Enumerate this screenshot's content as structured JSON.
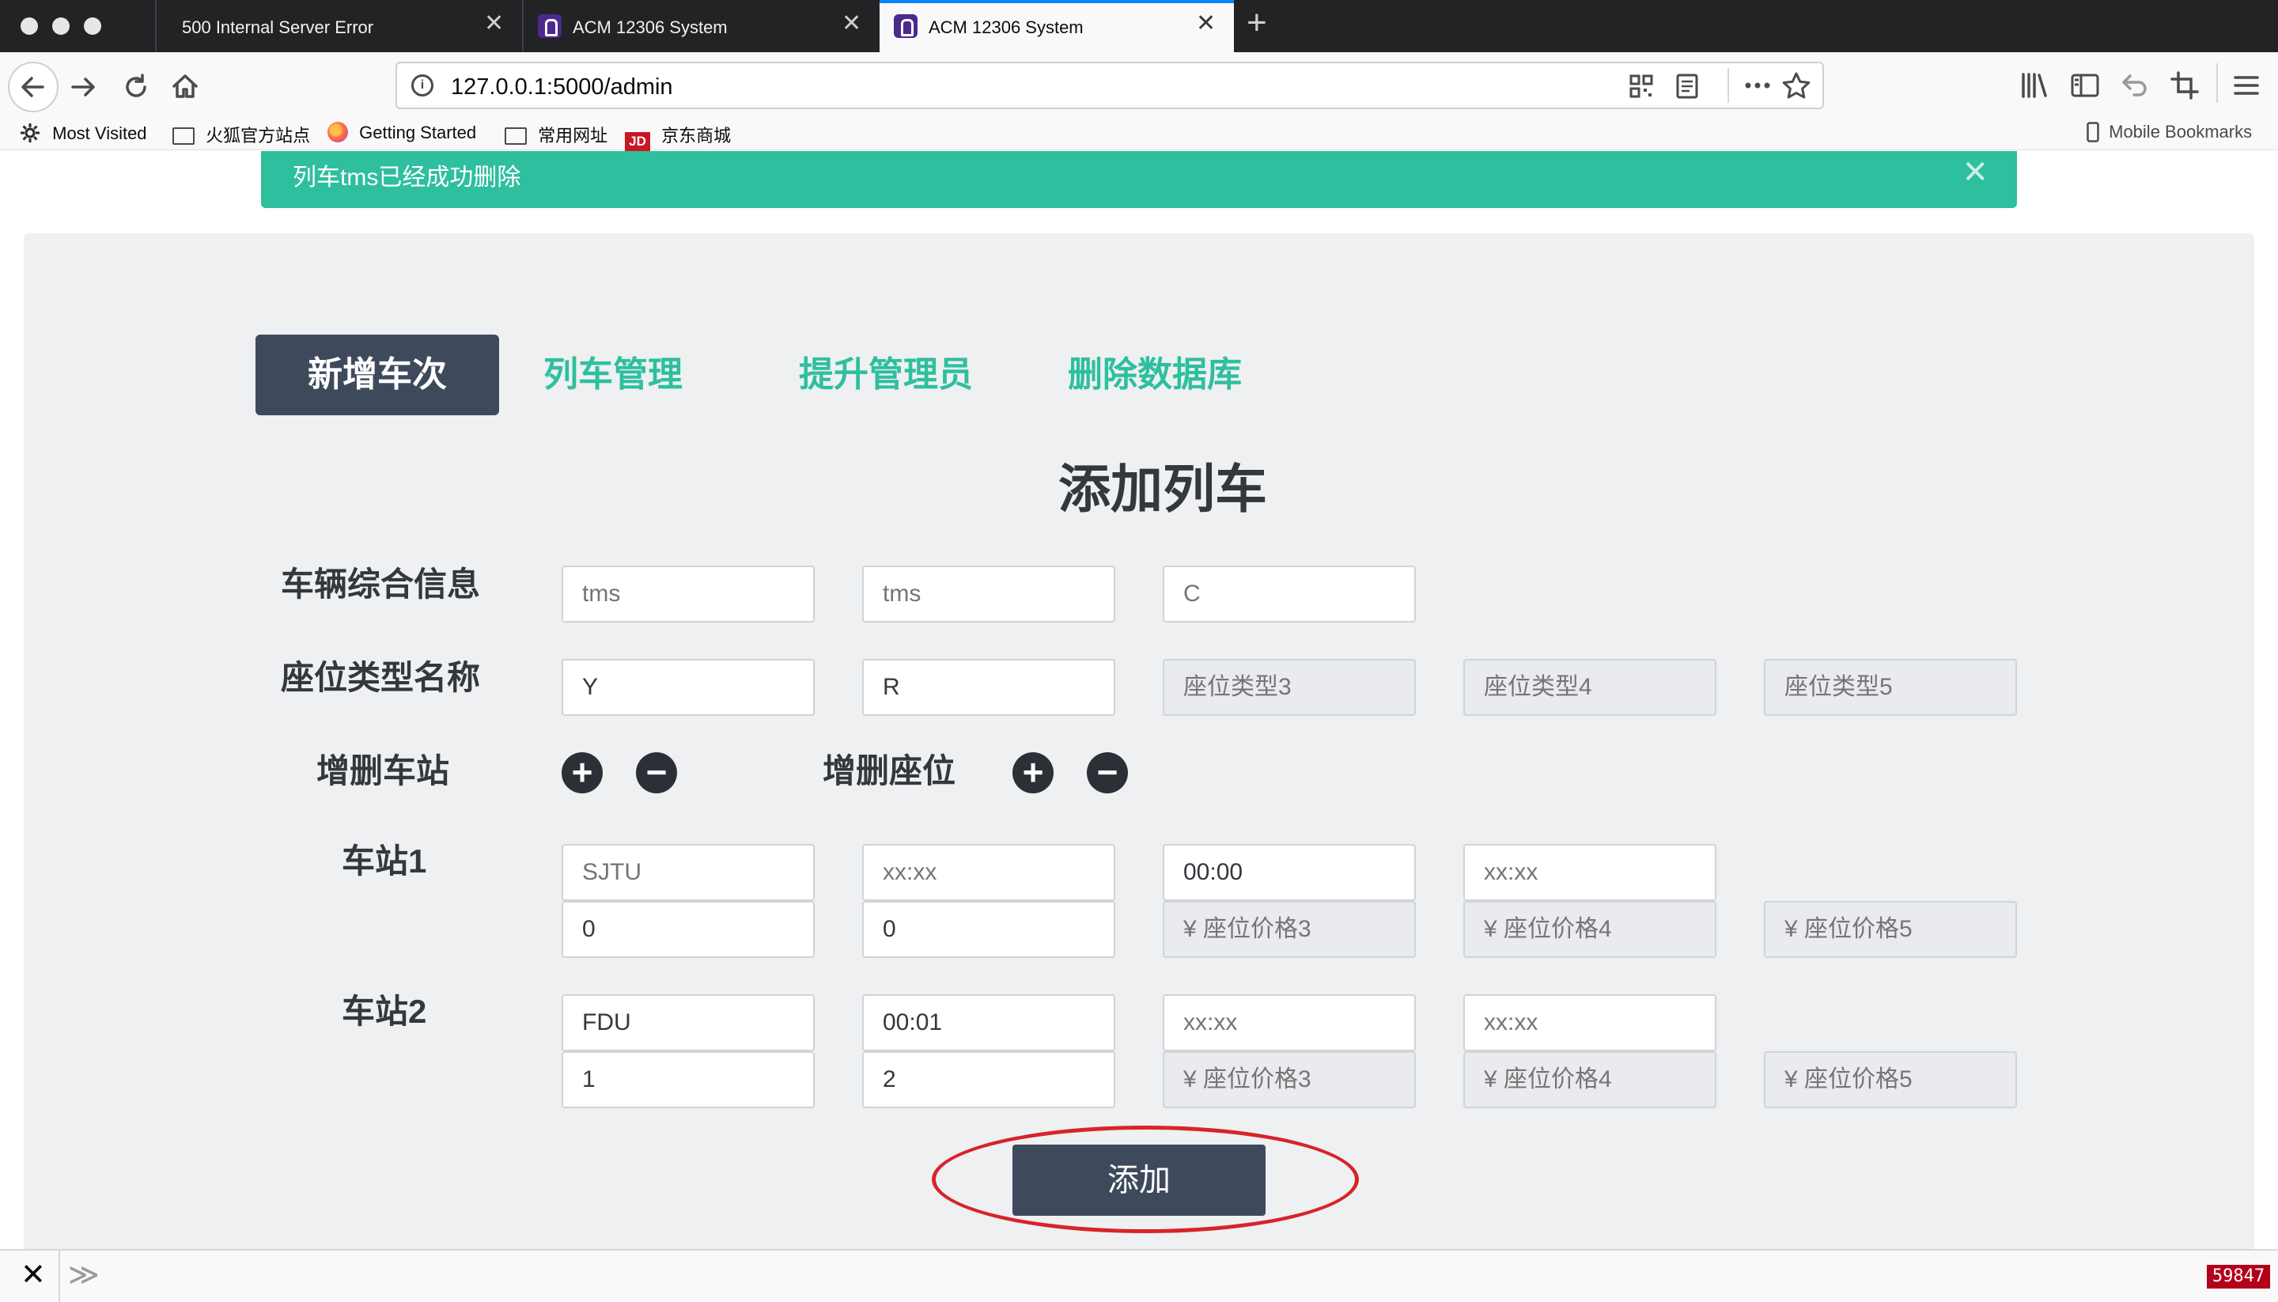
{
  "browser": {
    "tabs": [
      {
        "title": "500 Internal Server Error",
        "active": false
      },
      {
        "title": "ACM 12306 System",
        "active": false
      },
      {
        "title": "ACM 12306 System",
        "active": true
      }
    ],
    "new_tab_symbol": "+",
    "tab_close_symbol": "✕",
    "url": "127.0.0.1:5000/admin",
    "bookmarks": [
      {
        "label": "Most Visited",
        "icon": "gear-icon"
      },
      {
        "label": "火狐官方站点",
        "icon": "folder-icon"
      },
      {
        "label": "Getting Started",
        "icon": "firefox-icon"
      },
      {
        "label": "常用网址",
        "icon": "folder-icon"
      },
      {
        "label": "京东商城",
        "icon": "jd-icon"
      }
    ],
    "jd_icon_text": "JD",
    "mobile_bookmarks": "Mobile Bookmarks"
  },
  "alert": {
    "message": "列车tms已经成功删除",
    "close_symbol": "✕",
    "color": "#2ebf9e"
  },
  "nav": {
    "tabs": [
      {
        "label": "新增车次",
        "active": true
      },
      {
        "label": "列车管理",
        "active": false
      },
      {
        "label": "提升管理员",
        "active": false
      },
      {
        "label": "删除数据库",
        "active": false
      }
    ]
  },
  "form": {
    "title": "添加列车",
    "train_info_label": "车辆综合信息",
    "train_info": [
      {
        "value": "",
        "placeholder": "tms"
      },
      {
        "value": "",
        "placeholder": "tms"
      },
      {
        "value": "",
        "placeholder": "C"
      }
    ],
    "seat_type_label": "座位类型名称",
    "seat_types": [
      {
        "value": "Y",
        "placeholder": ""
      },
      {
        "value": "R",
        "placeholder": ""
      },
      {
        "value": "",
        "placeholder": "座位类型3"
      },
      {
        "value": "",
        "placeholder": "座位类型4"
      },
      {
        "value": "",
        "placeholder": "座位类型5"
      }
    ],
    "station_edit_label": "增删车站",
    "seat_edit_label": "增删座位",
    "plus_symbol": "+",
    "minus_symbol": "−",
    "stations": [
      {
        "label": "车站1",
        "row1": [
          {
            "value": "",
            "placeholder": "SJTU"
          },
          {
            "value": "",
            "placeholder": "xx:xx"
          },
          {
            "value": "00:00",
            "placeholder": ""
          },
          {
            "value": "",
            "placeholder": "xx:xx"
          }
        ],
        "row2": [
          {
            "value": "0",
            "placeholder": ""
          },
          {
            "value": "0",
            "placeholder": ""
          },
          {
            "value": "",
            "placeholder": "¥ 座位价格3"
          },
          {
            "value": "",
            "placeholder": "¥ 座位价格4"
          },
          {
            "value": "",
            "placeholder": "¥ 座位价格5"
          }
        ]
      },
      {
        "label": "车站2",
        "row1": [
          {
            "value": "FDU",
            "placeholder": ""
          },
          {
            "value": "00:01",
            "placeholder": ""
          },
          {
            "value": "",
            "placeholder": "xx:xx"
          },
          {
            "value": "",
            "placeholder": "xx:xx"
          }
        ],
        "row2": [
          {
            "value": "1",
            "placeholder": ""
          },
          {
            "value": "2",
            "placeholder": ""
          },
          {
            "value": "",
            "placeholder": "¥ 座位价格3"
          },
          {
            "value": "",
            "placeholder": "¥ 座位价格4"
          },
          {
            "value": "",
            "placeholder": "¥ 座位价格5"
          }
        ]
      }
    ],
    "submit_label": "添加"
  },
  "statusbar": {
    "close_symbol": "✕",
    "expand_symbol": "≫",
    "counter": "59847"
  },
  "colors": {
    "accent": "#2ebf9e",
    "nav_active_bg": "#3e4a5c",
    "annotation": "#d8232a",
    "counter_bg": "#b3001b"
  }
}
